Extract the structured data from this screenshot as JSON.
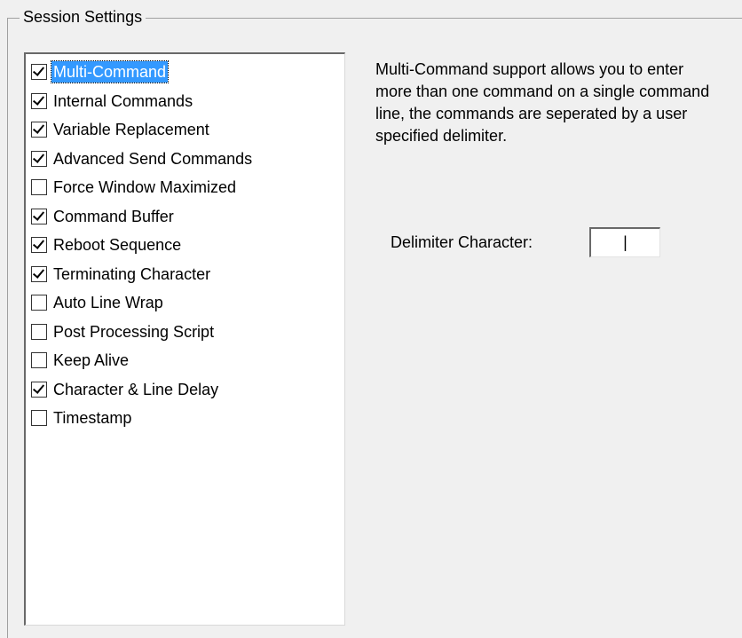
{
  "group": {
    "title": "Session Settings"
  },
  "options": [
    {
      "label": "Multi-Command",
      "checked": true,
      "selected": true
    },
    {
      "label": "Internal Commands",
      "checked": true,
      "selected": false
    },
    {
      "label": "Variable Replacement",
      "checked": true,
      "selected": false
    },
    {
      "label": "Advanced Send Commands",
      "checked": true,
      "selected": false
    },
    {
      "label": "Force Window Maximized",
      "checked": false,
      "selected": false
    },
    {
      "label": "Command Buffer",
      "checked": true,
      "selected": false
    },
    {
      "label": "Reboot Sequence",
      "checked": true,
      "selected": false
    },
    {
      "label": "Terminating Character",
      "checked": true,
      "selected": false
    },
    {
      "label": "Auto Line Wrap",
      "checked": false,
      "selected": false
    },
    {
      "label": "Post Processing Script",
      "checked": false,
      "selected": false
    },
    {
      "label": "Keep Alive",
      "checked": false,
      "selected": false
    },
    {
      "label": "Character & Line Delay",
      "checked": true,
      "selected": false
    },
    {
      "label": "Timestamp",
      "checked": false,
      "selected": false
    }
  ],
  "details": {
    "description": "Multi-Command support allows you to enter more than one command on a single command line, the commands are seperated by a user specified delimiter.",
    "delimiter_label": "Delimiter Character:",
    "delimiter_value": "|"
  }
}
